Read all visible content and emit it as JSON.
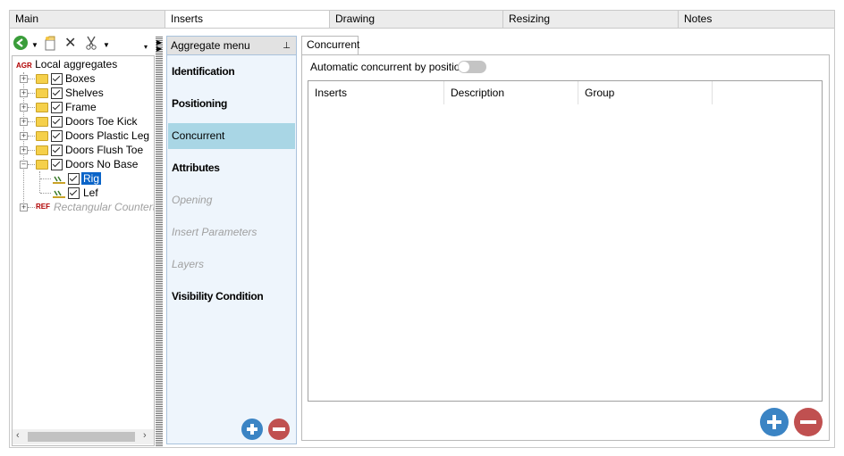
{
  "top_tabs": [
    {
      "label": "Main",
      "active": false
    },
    {
      "label": "Inserts",
      "active": true
    },
    {
      "label": "Drawing",
      "active": false
    },
    {
      "label": "Resizing",
      "active": false
    },
    {
      "label": "Notes",
      "active": false
    }
  ],
  "tree": {
    "root_prefix": "AGR",
    "root_label": "Local aggregates",
    "items": [
      "Boxes",
      "Shelves",
      "Frame",
      "Doors Toe Kick",
      "Doors Plastic Leg",
      "Doors Flush Toe",
      "Doors No Base"
    ],
    "children": [
      "Rig",
      "Lef"
    ],
    "ref_prefix": "REF",
    "ref_label": "Rectangular Counterto"
  },
  "aggregate_menu": {
    "title": "Aggregate menu",
    "items": [
      {
        "label": "Identification",
        "state": "bold"
      },
      {
        "label": "Positioning",
        "state": "bold"
      },
      {
        "label": "Concurrent",
        "state": "selected"
      },
      {
        "label": "Attributes",
        "state": "bold"
      },
      {
        "label": "Opening",
        "state": "disabled"
      },
      {
        "label": "Insert Parameters",
        "state": "disabled"
      },
      {
        "label": "Layers",
        "state": "disabled"
      },
      {
        "label": "Visibility Condition",
        "state": "bold"
      }
    ]
  },
  "concurrent": {
    "tab_label": "Concurrent",
    "toggle_label": "Automatic concurrent by position",
    "toggle_on": false,
    "columns": [
      "Inserts",
      "Description",
      "Group"
    ]
  },
  "colors": {
    "accent_selected": "#a9d6e5",
    "add_button": "#3b84c4",
    "remove_button": "#c05050"
  }
}
